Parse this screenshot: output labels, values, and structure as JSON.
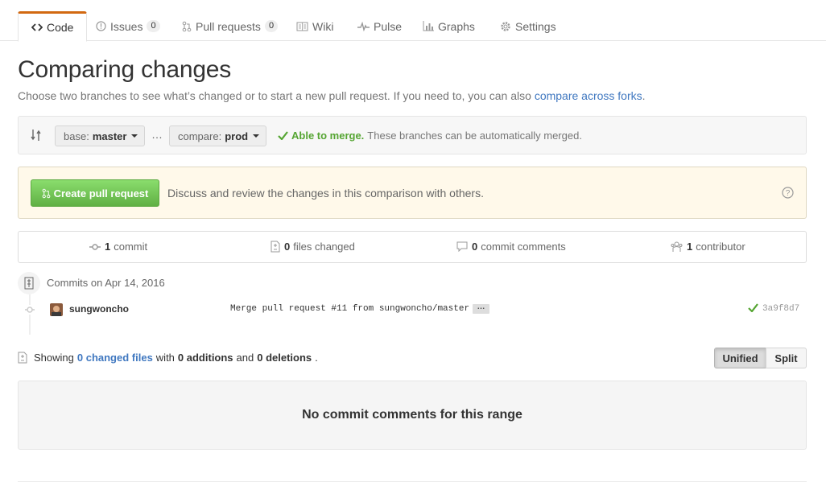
{
  "tabs": [
    {
      "label": "Code",
      "icon": "code-icon",
      "active": true
    },
    {
      "label": "Issues",
      "icon": "issue-icon",
      "count": "0"
    },
    {
      "label": "Pull requests",
      "icon": "pull-request-icon",
      "count": "0"
    },
    {
      "label": "Wiki",
      "icon": "book-icon"
    },
    {
      "label": "Pulse",
      "icon": "pulse-icon"
    },
    {
      "label": "Graphs",
      "icon": "graph-icon"
    },
    {
      "label": "Settings",
      "icon": "gear-icon"
    }
  ],
  "page": {
    "title": "Comparing changes",
    "subtitle": "Choose two branches to see what’s changed or to start a new pull request. If you need to, you can also",
    "subtitle_link": "compare across forks",
    "subtitle_end": "."
  },
  "range": {
    "base_label": "base:",
    "base_value": "master",
    "dots": "…",
    "compare_label": "compare:",
    "compare_value": "prod",
    "merge_status": "Able to merge.",
    "merge_text": "These branches can be automatically merged."
  },
  "banner": {
    "button": "Create pull request",
    "text": "Discuss and review the changes in this comparison with others."
  },
  "summary": {
    "commits_num": "1",
    "commits_label": "commit",
    "files_num": "0",
    "files_label": "files changed",
    "comments_num": "0",
    "comments_label": "commit comments",
    "contrib_num": "1",
    "contrib_label": "contributor"
  },
  "commits": {
    "day": "Commits on Apr 14, 2016",
    "author": "sungwoncho",
    "message": "Merge pull request #11 from sungwoncho/master",
    "ellipsis": "…",
    "sha": "3a9f8d7"
  },
  "diff": {
    "showing": "Showing",
    "changed": "0 changed files",
    "with": "with",
    "additions": "0 additions",
    "and": "and",
    "deletions": "0 deletions",
    "end": ".",
    "unified": "Unified",
    "split": "Split",
    "blank": "No commit comments for this range"
  },
  "colors": {
    "accent": "#d26911",
    "link": "#4078c0",
    "success": "#55a532"
  }
}
